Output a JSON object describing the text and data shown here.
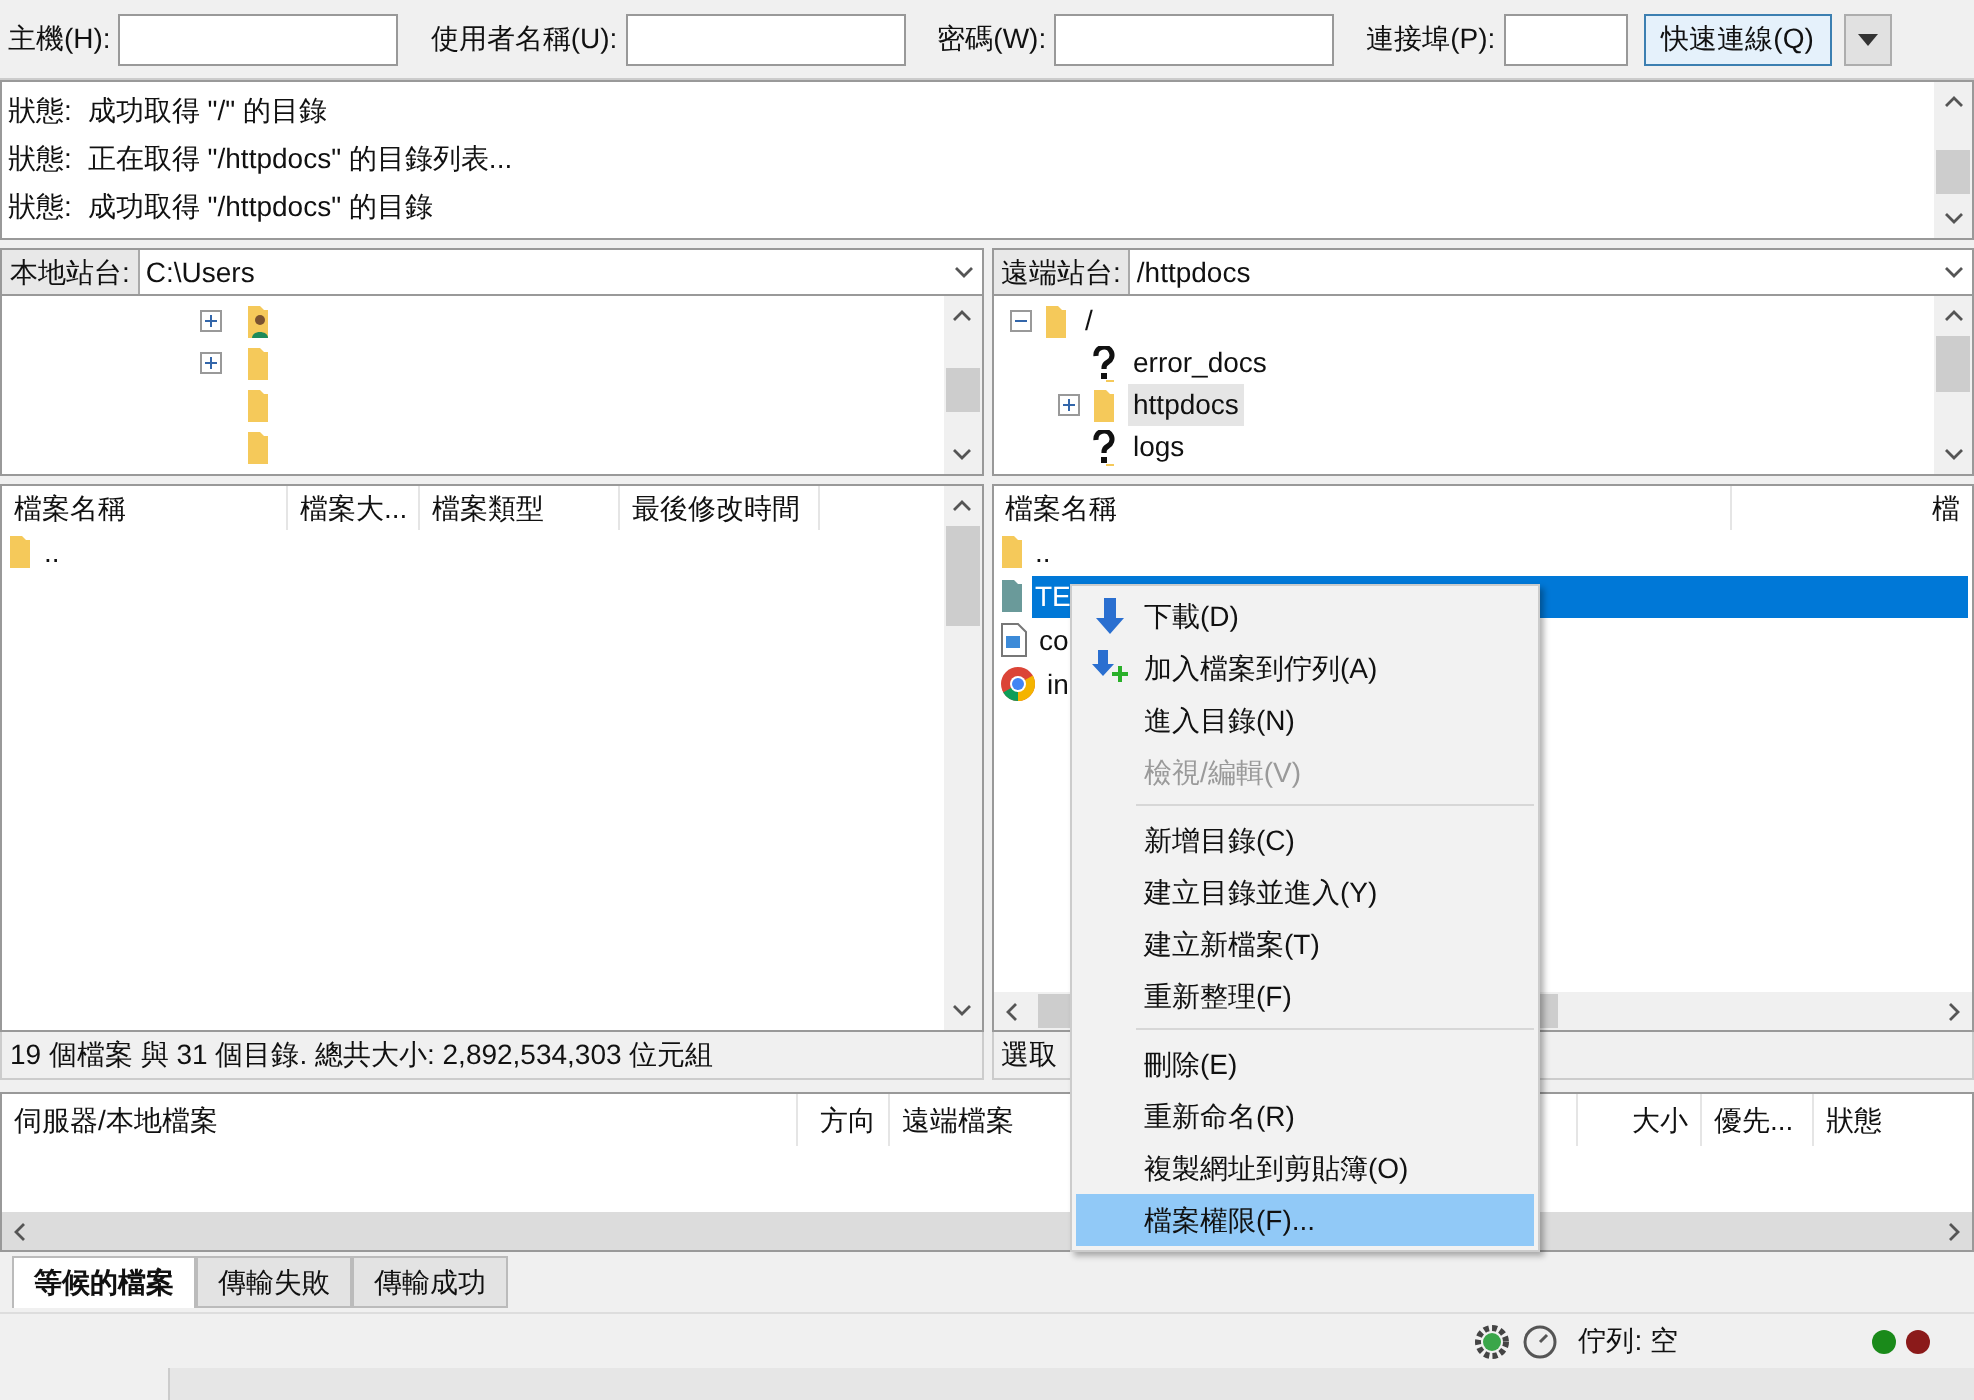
{
  "quickconnect": {
    "fields": [
      {
        "label": "主機(H):"
      },
      {
        "label": "使用者名稱(U):"
      },
      {
        "label": "密碼(W):"
      },
      {
        "label": "連接埠(P):"
      }
    ],
    "button": "快速連線(Q)"
  },
  "log": [
    {
      "label": "狀態:",
      "text": "成功取得 \"/\" 的目錄"
    },
    {
      "label": "狀態:",
      "text": "正在取得 \"/httpdocs\" 的目錄列表..."
    },
    {
      "label": "狀態:",
      "text": "成功取得 \"/httpdocs\" 的目錄"
    }
  ],
  "local": {
    "label": "本地站台:",
    "path": "C:\\Users",
    "tree": [
      {
        "kind": "user",
        "expandable": true
      },
      {
        "kind": "folder",
        "expandable": true
      },
      {
        "kind": "folder",
        "expandable": false
      },
      {
        "kind": "folder",
        "expandable": false
      }
    ],
    "columns": [
      "檔案名稱",
      "檔案大...",
      "檔案類型",
      "最後修改時間"
    ],
    "rows": [
      {
        "name": "..",
        "kind": "folder"
      }
    ],
    "status": "19 個檔案 與 31 個目錄. 總共大小: 2,892,534,303 位元組"
  },
  "remote": {
    "label": "遠端站台:",
    "path": "/httpdocs",
    "tree": [
      {
        "name": "/",
        "kind": "folder",
        "expanded": true,
        "selected": false,
        "children": [
          {
            "name": "error_docs",
            "kind": "unknown",
            "selected": false
          },
          {
            "name": "httpdocs",
            "kind": "folder",
            "expandable": true,
            "selected": true
          },
          {
            "name": "logs",
            "kind": "unknown",
            "selected": false
          }
        ]
      }
    ],
    "columns": [
      "檔案名稱",
      "檔"
    ],
    "rows": [
      {
        "name": "..",
        "kind": "folder",
        "selected": false
      },
      {
        "name": "TE",
        "kind": "folder",
        "selected": true
      },
      {
        "name": "co",
        "kind": "image",
        "selected": false
      },
      {
        "name": "in",
        "kind": "chrome",
        "selected": false
      }
    ],
    "status": "選取"
  },
  "context_menu": [
    {
      "kind": "download",
      "label": "下載(D)",
      "disabled": false,
      "selected": false
    },
    {
      "kind": "queue",
      "label": "加入檔案到佇列(A)",
      "disabled": false,
      "selected": false
    },
    {
      "kind": "item",
      "label": "進入目錄(N)",
      "disabled": false,
      "selected": false
    },
    {
      "kind": "item",
      "label": "檢視/編輯(V)",
      "disabled": true,
      "selected": false
    },
    {
      "kind": "separator"
    },
    {
      "kind": "item",
      "label": "新增目錄(C)",
      "disabled": false,
      "selected": false
    },
    {
      "kind": "item",
      "label": "建立目錄並進入(Y)",
      "disabled": false,
      "selected": false
    },
    {
      "kind": "item",
      "label": "建立新檔案(T)",
      "disabled": false,
      "selected": false
    },
    {
      "kind": "item",
      "label": "重新整理(F)",
      "disabled": false,
      "selected": false
    },
    {
      "kind": "separator"
    },
    {
      "kind": "item",
      "label": "刪除(E)",
      "disabled": false,
      "selected": false
    },
    {
      "kind": "item",
      "label": "重新命名(R)",
      "disabled": false,
      "selected": false
    },
    {
      "kind": "item",
      "label": "複製網址到剪貼簿(O)",
      "disabled": false,
      "selected": false
    },
    {
      "kind": "item",
      "label": "檔案權限(F)...",
      "disabled": false,
      "selected": true
    }
  ],
  "queue": {
    "columns": [
      "伺服器/本地檔案",
      "方向",
      "遠端檔案",
      "大小",
      "優先...",
      "狀態"
    ]
  },
  "tabs": [
    {
      "label": "等候的檔案",
      "selected": true
    },
    {
      "label": "傳輸失敗",
      "selected": false
    },
    {
      "label": "傳輸成功",
      "selected": false
    }
  ],
  "status_bar": {
    "queue": "佇列: 空"
  }
}
